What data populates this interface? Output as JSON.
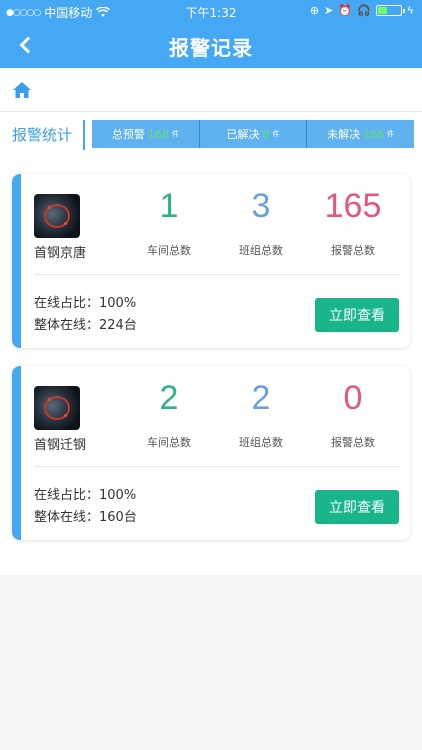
{
  "status_bar": {
    "signal": "●○○○○",
    "carrier": "中国移动",
    "time": "下午1:32"
  },
  "nav": {
    "title": "报警记录"
  },
  "stats": {
    "label": "报警统计",
    "items": [
      {
        "label": "总预警",
        "value": "168",
        "unit": "件"
      },
      {
        "label": "已解决",
        "value": "0",
        "unit": "件"
      },
      {
        "label": "未解决",
        "value": "168",
        "unit": "件"
      }
    ]
  },
  "colors": {
    "primary": "#45a8f4",
    "metric_green": "#2cb38a",
    "metric_blue": "#6a9fe0",
    "metric_red": "#e8557a",
    "button": "#19b58a"
  },
  "cards": [
    {
      "name": "首钢京唐",
      "metrics": [
        {
          "value": "1",
          "label": "车间总数"
        },
        {
          "value": "3",
          "label": "班组总数"
        },
        {
          "value": "165",
          "label": "报警总数"
        }
      ],
      "online_ratio": "在线占比：100%",
      "online_total": "整体在线：224台",
      "button": "立即查看"
    },
    {
      "name": "首钢迁钢",
      "metrics": [
        {
          "value": "2",
          "label": "车间总数"
        },
        {
          "value": "2",
          "label": "班组总数"
        },
        {
          "value": "0",
          "label": "报警总数"
        }
      ],
      "online_ratio": "在线占比：100%",
      "online_total": "整体在线：160台",
      "button": "立即查看"
    }
  ]
}
